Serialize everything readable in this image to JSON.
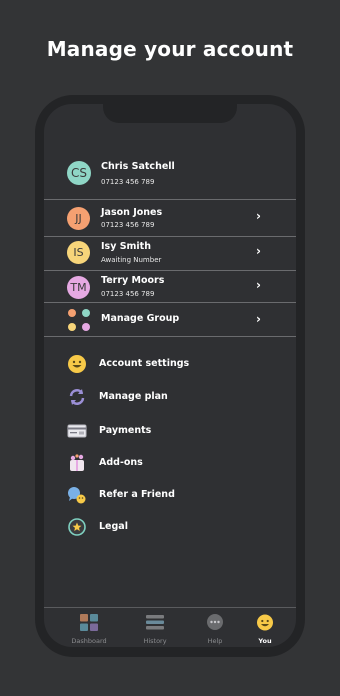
{
  "headline": "Manage your account",
  "contacts": [
    {
      "initials": "CS",
      "name": "Chris Satchell",
      "detail": "07123 456 789",
      "color": "#8fd6c6"
    },
    {
      "initials": "JJ",
      "name": "Jason Jones",
      "detail": "07123 456 789",
      "color": "#f5a071"
    },
    {
      "initials": "IS",
      "name": "Isy Smith",
      "detail": "Awaiting Number",
      "color": "#f7d57a"
    },
    {
      "initials": "TM",
      "name": "Terry Moors",
      "detail": "07123 456 789",
      "color": "#e6a9e3"
    }
  ],
  "manage_group_label": "Manage Group",
  "chevron": "›",
  "menu": [
    {
      "label": "Account settings",
      "icon": "smiley-icon"
    },
    {
      "label": "Manage plan",
      "icon": "refresh-icon"
    },
    {
      "label": "Payments",
      "icon": "card-icon"
    },
    {
      "label": "Add-ons",
      "icon": "addons-icon"
    },
    {
      "label": "Refer a Friend",
      "icon": "refer-icon"
    },
    {
      "label": "Legal",
      "icon": "star-badge-icon"
    }
  ],
  "tabs": [
    {
      "label": "Dashboard",
      "icon": "dashboard-icon"
    },
    {
      "label": "History",
      "icon": "history-icon"
    },
    {
      "label": "Help",
      "icon": "help-icon"
    },
    {
      "label": "You",
      "icon": "you-icon",
      "active": true
    }
  ],
  "colors": {
    "background": "#333436",
    "screen": "#2f3033",
    "accent": "#f7c948"
  }
}
